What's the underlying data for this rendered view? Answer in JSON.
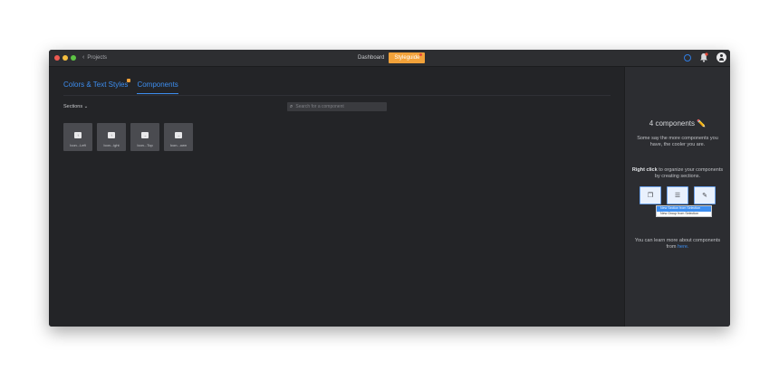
{
  "titlebar": {
    "back_label": "Projects",
    "tabs": [
      {
        "label": "Dashboard"
      },
      {
        "label": "Styleguide"
      }
    ]
  },
  "main": {
    "tabs": [
      {
        "label": "Colors & Text Styles"
      },
      {
        "label": "Components"
      }
    ],
    "sections_label": "Sections",
    "search_placeholder": "Search for a component",
    "components": [
      {
        "caption": "Icon...Left",
        "glyph": "↑"
      },
      {
        "caption": "Icon...ight",
        "glyph": "↑"
      },
      {
        "caption": "Icon...Top",
        "glyph": "→"
      },
      {
        "caption": "Icon...own",
        "glyph": "→"
      }
    ]
  },
  "panel": {
    "count": "4 components",
    "count_emoji": "✏️",
    "subtitle": "Some say the more components you have, the cooler you are.",
    "help_bold": "Right click",
    "help_rest": "to organize your components by creating sections.",
    "menu_items": [
      {
        "label": "New Section from Selection"
      },
      {
        "label": "New Group from Selection"
      }
    ],
    "learn_text": "You can learn more about components from",
    "learn_link": "here."
  },
  "colors": {
    "accent": "#3d8ef0",
    "highlight_tab": "#f2a23a",
    "background": "#232427",
    "panel": "#2c2d31"
  }
}
